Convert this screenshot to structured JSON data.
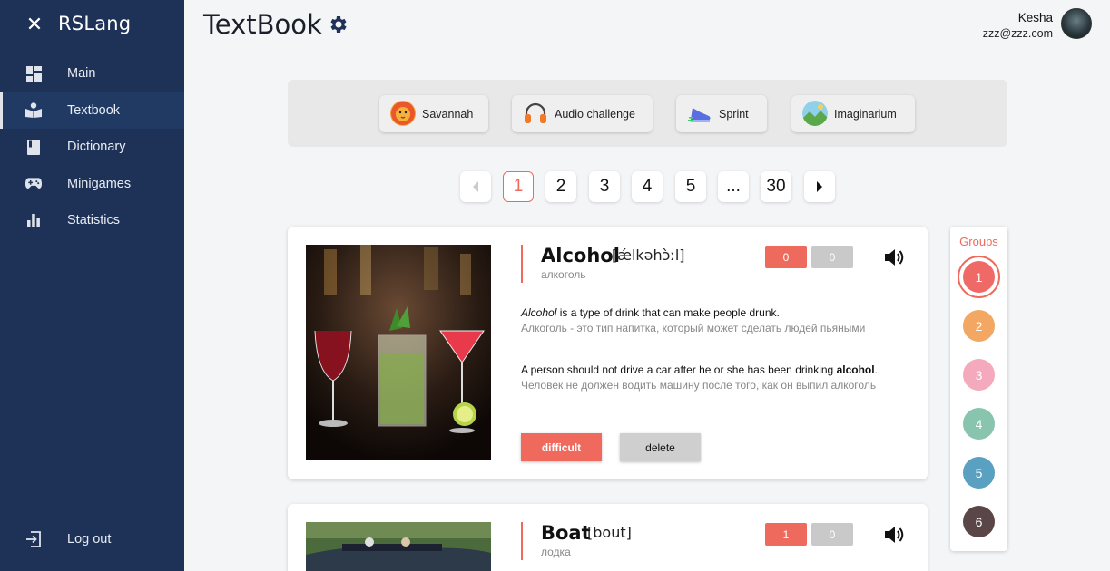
{
  "app": {
    "title": "RSLang"
  },
  "sidebar": {
    "items": [
      {
        "label": "Main",
        "icon": "dashboard-icon"
      },
      {
        "label": "Textbook",
        "icon": "book-icon",
        "active": true
      },
      {
        "label": "Dictionary",
        "icon": "dictionary-icon"
      },
      {
        "label": "Minigames",
        "icon": "gamepad-icon"
      },
      {
        "label": "Statistics",
        "icon": "bar-chart-icon"
      }
    ],
    "logout_label": "Log out"
  },
  "header": {
    "title": "TextBook",
    "user_name": "Kesha",
    "user_email": "zzz@zzz.com"
  },
  "games": [
    {
      "label": "Savannah",
      "icon": "lion-icon"
    },
    {
      "label": "Audio challenge",
      "icon": "headphones-icon"
    },
    {
      "label": "Sprint",
      "icon": "sneaker-icon"
    },
    {
      "label": "Imaginarium",
      "icon": "landscape-icon"
    }
  ],
  "pagination": {
    "pages": [
      "1",
      "2",
      "3",
      "4",
      "5",
      "...",
      "30"
    ],
    "current": "1"
  },
  "words": [
    {
      "word": "Alcohol",
      "transcription": "[ǽlkəhɔ̀ːl]",
      "translation": "алкоголь",
      "correct_count": "0",
      "wrong_count": "0",
      "meaning_em": "Alcohol",
      "meaning_rest": " is a type of drink that can make people drunk.",
      "meaning_ru": "Алкоголь - это тип напитка, который может сделать людей пьяными",
      "example_pre": "A person should not drive a car after he or she has been drinking ",
      "example_bold": "alcohol",
      "example_post": ".",
      "example_ru": "Человек не должен водить машину после того, как он выпил алкоголь",
      "difficult_label": "difficult",
      "delete_label": "delete"
    },
    {
      "word": "Boat",
      "transcription": "[bout]",
      "translation": "лодка",
      "correct_count": "1",
      "wrong_count": "0"
    }
  ],
  "groups": {
    "title": "Groups",
    "items": [
      {
        "label": "1",
        "color": "#ef6a66"
      },
      {
        "label": "2",
        "color": "#f2a863"
      },
      {
        "label": "3",
        "color": "#f5a9bd"
      },
      {
        "label": "4",
        "color": "#88c4ae"
      },
      {
        "label": "5",
        "color": "#5aa0c0"
      },
      {
        "label": "6",
        "color": "#5a4647"
      }
    ],
    "selected": "1"
  },
  "colors": {
    "sidebar_bg": "#1e3258",
    "accent": "#ef6a5c"
  }
}
